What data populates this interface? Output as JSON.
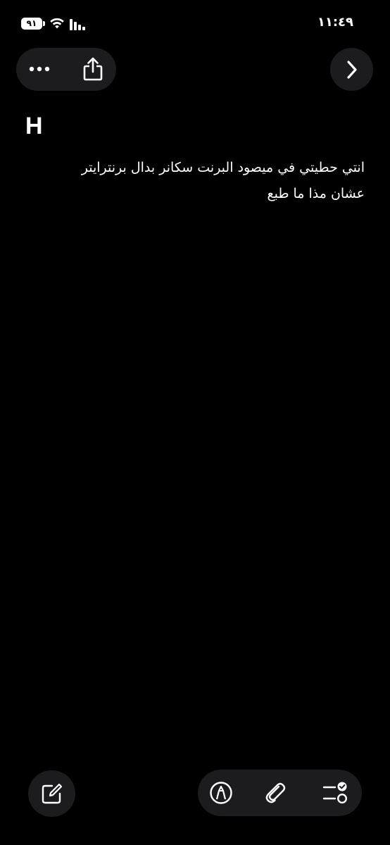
{
  "status_bar": {
    "battery": "٩١",
    "time": "١١:٤٩",
    "wifi_icon": "wifi-icon",
    "signal_icon": "cellular-signal-icon"
  },
  "toolbar": {
    "more_icon": "ellipsis-icon",
    "share_icon": "share-icon",
    "next_icon": "chevron-right-icon"
  },
  "note": {
    "title": "H",
    "body_line1": "انتي حطيتي في ميصود البرنت سكانر بدال برنترايتر",
    "body_line2": "عشان مذا ما طبع"
  },
  "bottom_bar": {
    "compose_icon": "compose-icon",
    "markup_icon": "markup-pen-icon",
    "attachment_icon": "paperclip-icon",
    "checklist_icon": "checklist-icon"
  }
}
